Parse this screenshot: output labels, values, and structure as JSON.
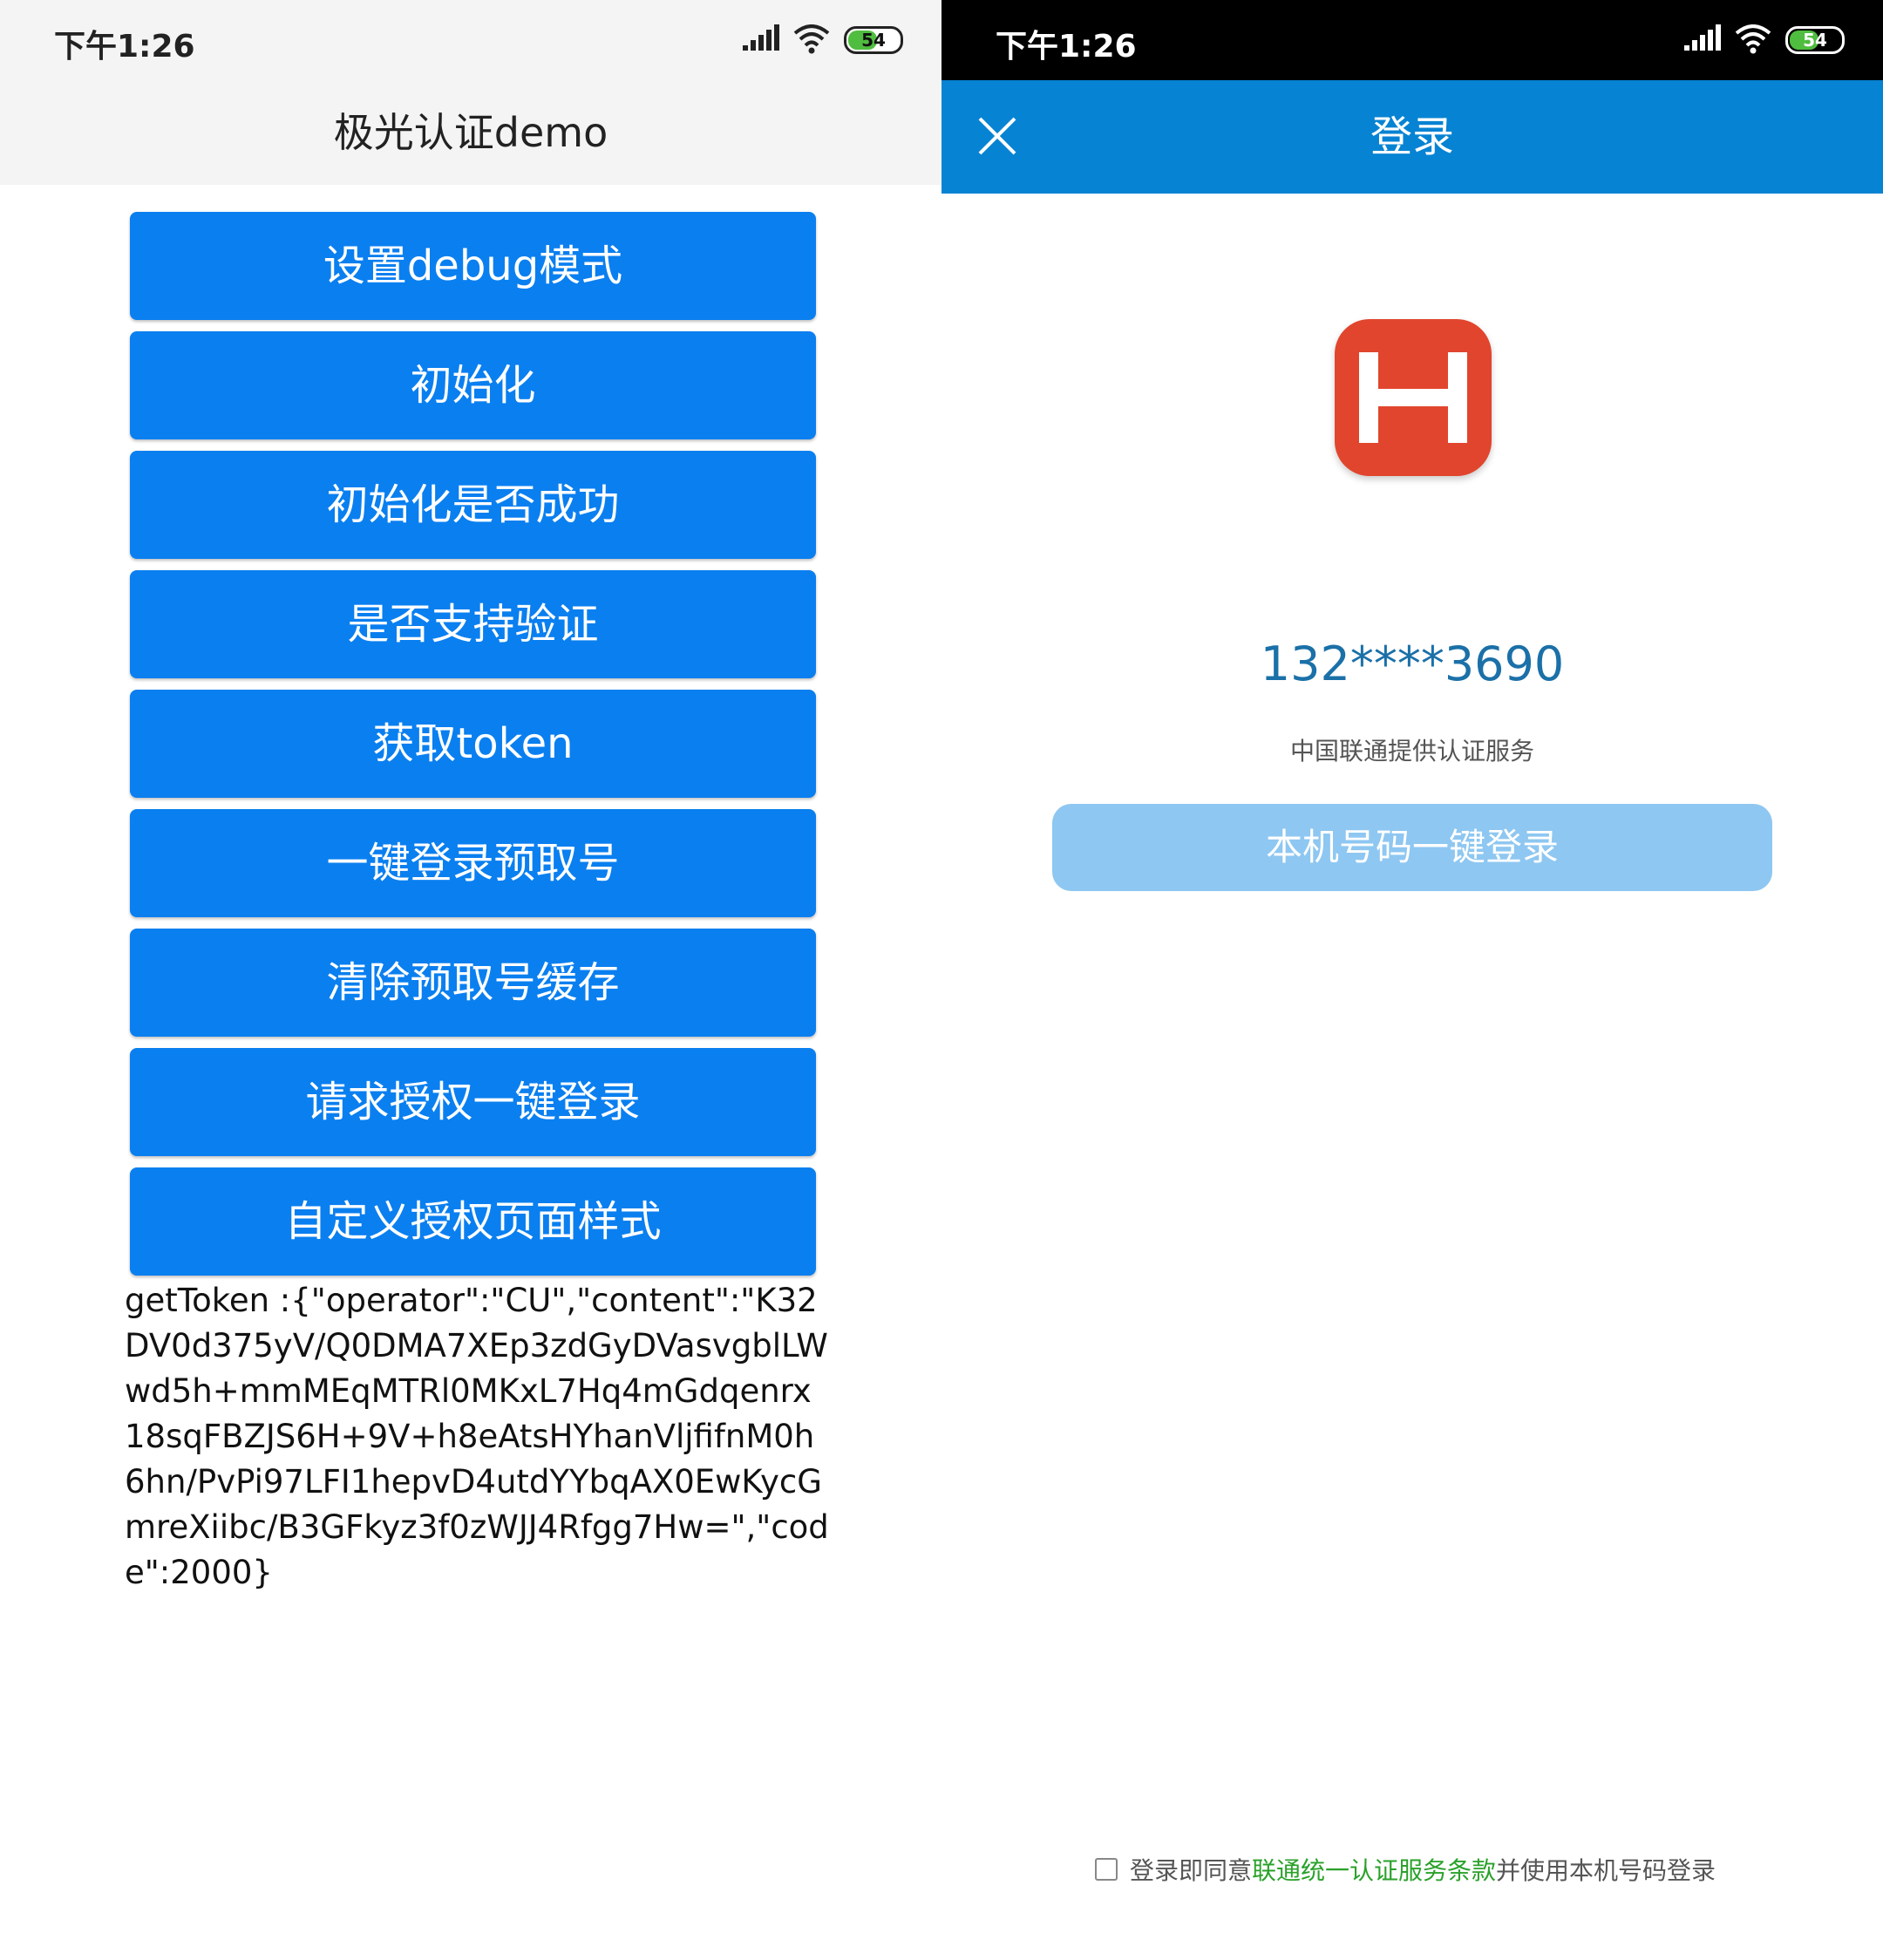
{
  "left": {
    "status": {
      "time": "下午1:26",
      "battery": "54"
    },
    "header_title": "极光认证demo",
    "buttons": [
      "设置debug模式",
      "初始化",
      "初始化是否成功",
      "是否支持验证",
      "获取token",
      "一键登录预取号",
      "清除预取号缓存",
      "请求授权一键登录",
      "自定义授权页面样式"
    ],
    "token_output": "getToken :{\"operator\":\"CU\",\"content\":\"K32DV0d375yV/Q0DMA7XEp3zdGyDVasvgblLWwd5h+mmMEqMTRl0MKxL7Hq4mGdqenrx18sqFBZJS6H+9V+h8eAtsHYhanVljfifnM0h6hn/PvPi97LFI1hepvD4utdYYbqAX0EwKycGmreXiibc/B3GFkyz3f0zWJJ4Rfgg7Hw=\",\"code\":2000}"
  },
  "right": {
    "status": {
      "time": "下午1:26",
      "battery": "54"
    },
    "header_title": "登录",
    "close_icon": "close-icon",
    "logo_letter": "H",
    "phone_number": "132****3690",
    "provider_text": "中国联通提供认证服务",
    "login_button": "本机号码一键登录",
    "agreement": {
      "prefix": "登录即同意",
      "link": "联通统一认证服务条款",
      "suffix": "并使用本机号码登录"
    }
  },
  "colors": {
    "button_blue": "#0a7ff0",
    "header_blue": "#0783d3",
    "login_button": "#8ec7f1",
    "phone_number": "#1b70a8",
    "agreement_link": "#2aa12a",
    "logo": "#e1452d"
  }
}
